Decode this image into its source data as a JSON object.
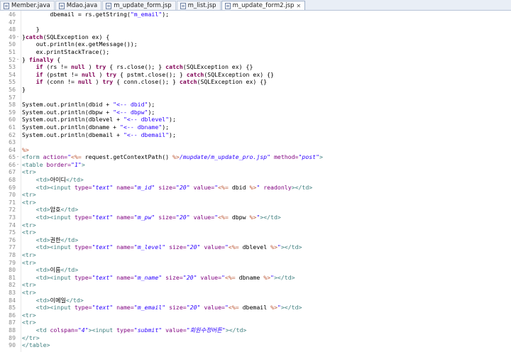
{
  "tabs": [
    {
      "label": "Member.java",
      "active": false
    },
    {
      "label": "Mdao.java",
      "active": false
    },
    {
      "label": "m_update_form.jsp",
      "active": false
    },
    {
      "label": "m_list.jsp",
      "active": false
    },
    {
      "label": "m_update_form2.jsp",
      "active": true
    }
  ],
  "close_glyph": "✕",
  "lines": [
    {
      "n": "46",
      "f": "",
      "t": [
        [
          "",
          "        dbemail = rs.getString("
        ],
        [
          "str",
          "\"m_email\""
        ],
        [
          "",
          ");"
        ]
      ]
    },
    {
      "n": "47",
      "f": "",
      "t": [
        [
          "",
          ""
        ]
      ]
    },
    {
      "n": "48",
      "f": "",
      "t": [
        [
          "",
          "    }"
        ]
      ]
    },
    {
      "n": "49",
      "f": "-",
      "t": [
        [
          "",
          "}"
        ],
        [
          "kw",
          "catch"
        ],
        [
          "",
          "(SQLException ex) {"
        ]
      ]
    },
    {
      "n": "50",
      "f": "",
      "t": [
        [
          "",
          "    out.println(ex.getMessage());"
        ]
      ]
    },
    {
      "n": "51",
      "f": "",
      "t": [
        [
          "",
          "    ex.printStackTrace();"
        ]
      ]
    },
    {
      "n": "52",
      "f": "-",
      "t": [
        [
          "",
          "} "
        ],
        [
          "kw",
          "finally"
        ],
        [
          "",
          " {"
        ]
      ]
    },
    {
      "n": "53",
      "f": "",
      "t": [
        [
          "",
          "    "
        ],
        [
          "kw",
          "if"
        ],
        [
          "",
          " (rs != "
        ],
        [
          "kw",
          "null"
        ],
        [
          "",
          " ) "
        ],
        [
          "kw",
          "try"
        ],
        [
          "",
          " { rs.close(); } "
        ],
        [
          "kw",
          "catch"
        ],
        [
          "",
          "(SQLException ex) {}"
        ]
      ]
    },
    {
      "n": "54",
      "f": "",
      "t": [
        [
          "",
          "    "
        ],
        [
          "kw",
          "if"
        ],
        [
          "",
          " (pstmt != "
        ],
        [
          "kw",
          "null"
        ],
        [
          "",
          " ) "
        ],
        [
          "kw",
          "try"
        ],
        [
          "",
          " { pstmt.close(); } "
        ],
        [
          "kw",
          "catch"
        ],
        [
          "",
          "(SQLException ex) {}"
        ]
      ]
    },
    {
      "n": "55",
      "f": "",
      "t": [
        [
          "",
          "    "
        ],
        [
          "kw",
          "if"
        ],
        [
          "",
          " (conn != "
        ],
        [
          "kw",
          "null"
        ],
        [
          "",
          " ) "
        ],
        [
          "kw",
          "try"
        ],
        [
          "",
          " { conn.close(); } "
        ],
        [
          "kw",
          "catch"
        ],
        [
          "",
          "(SQLException ex) {}"
        ]
      ]
    },
    {
      "n": "56",
      "f": "",
      "t": [
        [
          "",
          "}"
        ]
      ]
    },
    {
      "n": "57",
      "f": "",
      "t": [
        [
          "",
          ""
        ]
      ]
    },
    {
      "n": "58",
      "f": "",
      "t": [
        [
          "",
          "System.out.println(dbid + "
        ],
        [
          "str",
          "\"<-- dbid\""
        ],
        [
          "",
          ");"
        ]
      ]
    },
    {
      "n": "59",
      "f": "",
      "t": [
        [
          "",
          "System.out.println(dbpw + "
        ],
        [
          "str",
          "\"<-- dbpw\""
        ],
        [
          "",
          ");"
        ]
      ]
    },
    {
      "n": "60",
      "f": "",
      "t": [
        [
          "",
          "System.out.println(dblevel + "
        ],
        [
          "str",
          "\"<-- dblevel\""
        ],
        [
          "",
          ");"
        ]
      ]
    },
    {
      "n": "61",
      "f": "",
      "t": [
        [
          "",
          "System.out.println(dbname + "
        ],
        [
          "str",
          "\"<-- dbname\""
        ],
        [
          "",
          ");"
        ]
      ]
    },
    {
      "n": "62",
      "f": "",
      "t": [
        [
          "",
          "System.out.println(dbemail + "
        ],
        [
          "str",
          "\"<-- dbemail\""
        ],
        [
          "",
          ");"
        ]
      ]
    },
    {
      "n": "63",
      "f": "",
      "t": [
        [
          "",
          ""
        ]
      ]
    },
    {
      "n": "64",
      "f": "",
      "t": [
        [
          "jsp",
          "%>"
        ]
      ]
    },
    {
      "n": "65",
      "f": "-",
      "t": [
        [
          "tag",
          "<form "
        ],
        [
          "attr",
          "action="
        ],
        [
          "aval",
          "\""
        ],
        [
          "jsp",
          "<%="
        ],
        [
          "",
          " request.getContextPath() "
        ],
        [
          "jsp",
          "%>"
        ],
        [
          "aval",
          "/mupdate/m_update_pro.jsp\""
        ],
        [
          "attr",
          " method="
        ],
        [
          "aval",
          "\"post\""
        ],
        [
          "tag",
          ">"
        ]
      ]
    },
    {
      "n": "66",
      "f": "-",
      "t": [
        [
          "tag",
          "<table "
        ],
        [
          "attr",
          "border="
        ],
        [
          "aval",
          "\"1\""
        ],
        [
          "tag",
          ">"
        ]
      ]
    },
    {
      "n": "67",
      "f": "",
      "t": [
        [
          "tag",
          "<tr>"
        ]
      ]
    },
    {
      "n": "68",
      "f": "",
      "t": [
        [
          "",
          "    "
        ],
        [
          "tag",
          "<td>"
        ],
        [
          "txt",
          "아이디"
        ],
        [
          "tag",
          "</td>"
        ]
      ]
    },
    {
      "n": "69",
      "f": "",
      "t": [
        [
          "",
          "    "
        ],
        [
          "tag",
          "<td><input "
        ],
        [
          "attr",
          "type="
        ],
        [
          "aval",
          "\"text\""
        ],
        [
          "attr",
          " name="
        ],
        [
          "aval",
          "\"m_id\""
        ],
        [
          "attr",
          " size="
        ],
        [
          "aval",
          "\"20\""
        ],
        [
          "attr",
          " value="
        ],
        [
          "aval",
          "\""
        ],
        [
          "jsp",
          "<%="
        ],
        [
          "",
          " dbid "
        ],
        [
          "jsp",
          "%>"
        ],
        [
          "aval",
          "\""
        ],
        [
          "attr",
          " readonly"
        ],
        [
          "tag",
          "></td>"
        ]
      ]
    },
    {
      "n": "70",
      "f": "",
      "t": [
        [
          "tag",
          "<tr>"
        ]
      ]
    },
    {
      "n": "71",
      "f": "",
      "t": [
        [
          "tag",
          "<tr>"
        ]
      ]
    },
    {
      "n": "72",
      "f": "",
      "t": [
        [
          "",
          "    "
        ],
        [
          "tag",
          "<td>"
        ],
        [
          "txt",
          "암호"
        ],
        [
          "tag",
          "</td>"
        ]
      ]
    },
    {
      "n": "73",
      "f": "",
      "t": [
        [
          "",
          "    "
        ],
        [
          "tag",
          "<td><input "
        ],
        [
          "attr",
          "type="
        ],
        [
          "aval",
          "\"text\""
        ],
        [
          "attr",
          " name="
        ],
        [
          "aval",
          "\"m_pw\""
        ],
        [
          "attr",
          " size="
        ],
        [
          "aval",
          "\"20\""
        ],
        [
          "attr",
          " value="
        ],
        [
          "aval",
          "\""
        ],
        [
          "jsp",
          "<%="
        ],
        [
          "",
          " dbpw "
        ],
        [
          "jsp",
          "%>"
        ],
        [
          "aval",
          "\""
        ],
        [
          "tag",
          "></td>"
        ]
      ]
    },
    {
      "n": "74",
      "f": "",
      "t": [
        [
          "tag",
          "<tr>"
        ]
      ]
    },
    {
      "n": "75",
      "f": "",
      "t": [
        [
          "tag",
          "<tr>"
        ]
      ]
    },
    {
      "n": "76",
      "f": "",
      "t": [
        [
          "",
          "    "
        ],
        [
          "tag",
          "<td>"
        ],
        [
          "txt",
          "권한"
        ],
        [
          "tag",
          "</td>"
        ]
      ]
    },
    {
      "n": "77",
      "f": "",
      "t": [
        [
          "",
          "    "
        ],
        [
          "tag",
          "<td><input "
        ],
        [
          "attr",
          "type="
        ],
        [
          "aval",
          "\"text\""
        ],
        [
          "attr",
          " name="
        ],
        [
          "aval",
          "\"m_level\""
        ],
        [
          "attr",
          " size="
        ],
        [
          "aval",
          "\"20\""
        ],
        [
          "attr",
          " value="
        ],
        [
          "aval",
          "\""
        ],
        [
          "jsp",
          "<%="
        ],
        [
          "",
          " dblevel "
        ],
        [
          "jsp",
          "%>"
        ],
        [
          "aval",
          "\""
        ],
        [
          "tag",
          "></td>"
        ]
      ]
    },
    {
      "n": "78",
      "f": "",
      "t": [
        [
          "tag",
          "<tr>"
        ]
      ]
    },
    {
      "n": "79",
      "f": "",
      "t": [
        [
          "tag",
          "<tr>"
        ]
      ]
    },
    {
      "n": "80",
      "f": "",
      "t": [
        [
          "",
          "    "
        ],
        [
          "tag",
          "<td>"
        ],
        [
          "txt",
          "이름"
        ],
        [
          "tag",
          "</td>"
        ]
      ]
    },
    {
      "n": "81",
      "f": "",
      "t": [
        [
          "",
          "    "
        ],
        [
          "tag",
          "<td><input "
        ],
        [
          "attr",
          "type="
        ],
        [
          "aval",
          "\"text\""
        ],
        [
          "attr",
          " name="
        ],
        [
          "aval",
          "\"m_name\""
        ],
        [
          "attr",
          " size="
        ],
        [
          "aval",
          "\"20\""
        ],
        [
          "attr",
          " value="
        ],
        [
          "aval",
          "\""
        ],
        [
          "jsp",
          "<%="
        ],
        [
          "",
          " dbname "
        ],
        [
          "jsp",
          "%>"
        ],
        [
          "aval",
          "\""
        ],
        [
          "tag",
          "></td>"
        ]
      ]
    },
    {
      "n": "82",
      "f": "",
      "t": [
        [
          "tag",
          "<tr>"
        ]
      ]
    },
    {
      "n": "83",
      "f": "",
      "t": [
        [
          "tag",
          "<tr>"
        ]
      ]
    },
    {
      "n": "84",
      "f": "",
      "t": [
        [
          "",
          "    "
        ],
        [
          "tag",
          "<td>"
        ],
        [
          "txt",
          "이메일"
        ],
        [
          "tag",
          "</td>"
        ]
      ]
    },
    {
      "n": "85",
      "f": "",
      "t": [
        [
          "",
          "    "
        ],
        [
          "tag",
          "<td><input "
        ],
        [
          "attr",
          "type="
        ],
        [
          "aval",
          "\"text\""
        ],
        [
          "attr",
          " name="
        ],
        [
          "aval",
          "\"m_email\""
        ],
        [
          "attr",
          " size="
        ],
        [
          "aval",
          "\"20\""
        ],
        [
          "attr",
          " value="
        ],
        [
          "aval",
          "\""
        ],
        [
          "jsp",
          "<%="
        ],
        [
          "",
          " dbemail "
        ],
        [
          "jsp",
          "%>"
        ],
        [
          "aval",
          "\""
        ],
        [
          "tag",
          "></td>"
        ]
      ]
    },
    {
      "n": "86",
      "f": "",
      "t": [
        [
          "tag",
          "<tr>"
        ]
      ]
    },
    {
      "n": "87",
      "f": "",
      "t": [
        [
          "tag",
          "<tr>"
        ]
      ]
    },
    {
      "n": "88",
      "f": "",
      "t": [
        [
          "",
          "    "
        ],
        [
          "tag",
          "<td "
        ],
        [
          "attr",
          "colspan="
        ],
        [
          "aval",
          "\"4\""
        ],
        [
          "tag",
          "><input "
        ],
        [
          "attr",
          "type="
        ],
        [
          "aval",
          "\"submit\""
        ],
        [
          "attr",
          " value="
        ],
        [
          "aval",
          "\"회원수정버튼\""
        ],
        [
          "tag",
          "></td>"
        ]
      ]
    },
    {
      "n": "89",
      "f": "",
      "t": [
        [
          "tag",
          "</tr>"
        ]
      ]
    },
    {
      "n": "90",
      "f": "",
      "t": [
        [
          "tag",
          "</table>"
        ]
      ]
    }
  ]
}
